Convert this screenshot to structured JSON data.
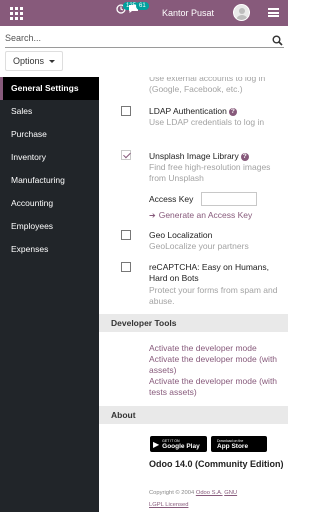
{
  "topbar": {
    "apps_icon": "grid-icon",
    "activity_count": "125",
    "activity_icon": "clock-icon",
    "messages_count": "61",
    "messages_icon": "chat-icon",
    "company_name": "Kantor Pusat",
    "menu_icon": "hamburger-icon",
    "color": "#875a7b"
  },
  "search": {
    "placeholder": "Search...",
    "icon": "search-icon"
  },
  "options": {
    "label": "Options"
  },
  "sidebar": {
    "items": [
      {
        "label": "General Settings",
        "active": true
      },
      {
        "label": "Sales"
      },
      {
        "label": "Purchase"
      },
      {
        "label": "Inventory"
      },
      {
        "label": "Manufacturing"
      },
      {
        "label": "Accounting"
      },
      {
        "label": "Employees"
      },
      {
        "label": "Expenses"
      }
    ]
  },
  "settings": {
    "oauth_desc": "Use external accounts to log in (Google, Facebook, etc.)",
    "ldap": {
      "title": "LDAP Authentication",
      "desc": "Use LDAP credentials to log in",
      "checked": false
    },
    "unsplash": {
      "title": "Unsplash Image Library",
      "desc": "Find free high-resolution images from Unsplash",
      "checked": true,
      "key_label": "Access Key",
      "key_value": "",
      "generate_link": "Generate an Access Key"
    },
    "geo": {
      "title": "Geo Localization",
      "desc": "GeoLocalize your partners",
      "checked": false
    },
    "recaptcha": {
      "title": "reCAPTCHA: Easy on Humans, Hard on Bots",
      "desc": "Protect your forms from spam and abuse.",
      "checked": false
    }
  },
  "developer": {
    "header": "Developer Tools",
    "links": [
      "Activate the developer mode",
      "Activate the developer mode (with assets)",
      "Activate the developer mode (with tests assets)"
    ]
  },
  "about": {
    "header": "About",
    "google_play": {
      "small": "GET IT ON",
      "big": "Google Play"
    },
    "app_store": {
      "small": "Download on the",
      "big": "App Store"
    },
    "version": "Odoo 14.0 (Community Edition)",
    "copyright": "Copyright © 2004",
    "company_link": "Odoo S.A.",
    "license_link1": "GNU",
    "license_link2": "LGPL Licensed"
  }
}
